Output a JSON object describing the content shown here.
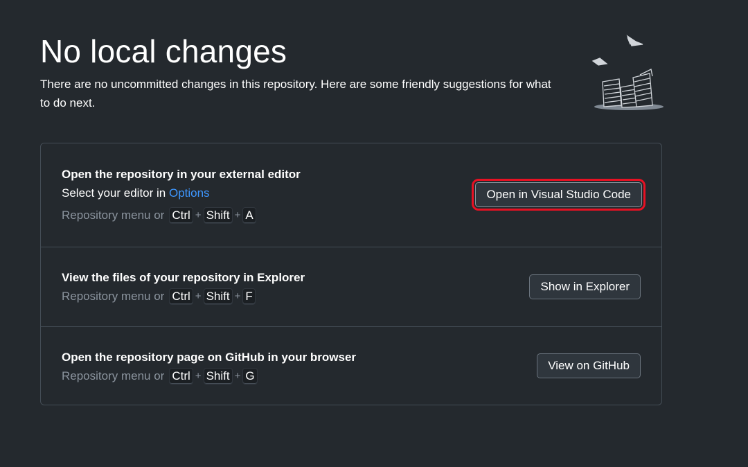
{
  "header": {
    "title": "No local changes",
    "subtitle": "There are no uncommitted changes in this repository. Here are some friendly suggestions for what to do next."
  },
  "actions": [
    {
      "title": "Open the repository in your external editor",
      "description_prefix": "Select your editor in ",
      "description_link": "Options",
      "shortcut_prefix": "Repository menu or",
      "keys": [
        "Ctrl",
        "Shift",
        "A"
      ],
      "button_label": "Open in Visual Studio Code"
    },
    {
      "title": "View the files of your repository in Explorer",
      "shortcut_prefix": "Repository menu or",
      "keys": [
        "Ctrl",
        "Shift",
        "F"
      ],
      "button_label": "Show in Explorer"
    },
    {
      "title": "Open the repository page on GitHub in your browser",
      "shortcut_prefix": "Repository menu or",
      "keys": [
        "Ctrl",
        "Shift",
        "G"
      ],
      "button_label": "View on GitHub"
    }
  ],
  "plus_symbol": "+",
  "colors": {
    "background": "#24292e",
    "link": "#3e97ff",
    "highlight": "#e81123"
  },
  "icons": {
    "illustration": "empty-paper-pile-illustration"
  }
}
